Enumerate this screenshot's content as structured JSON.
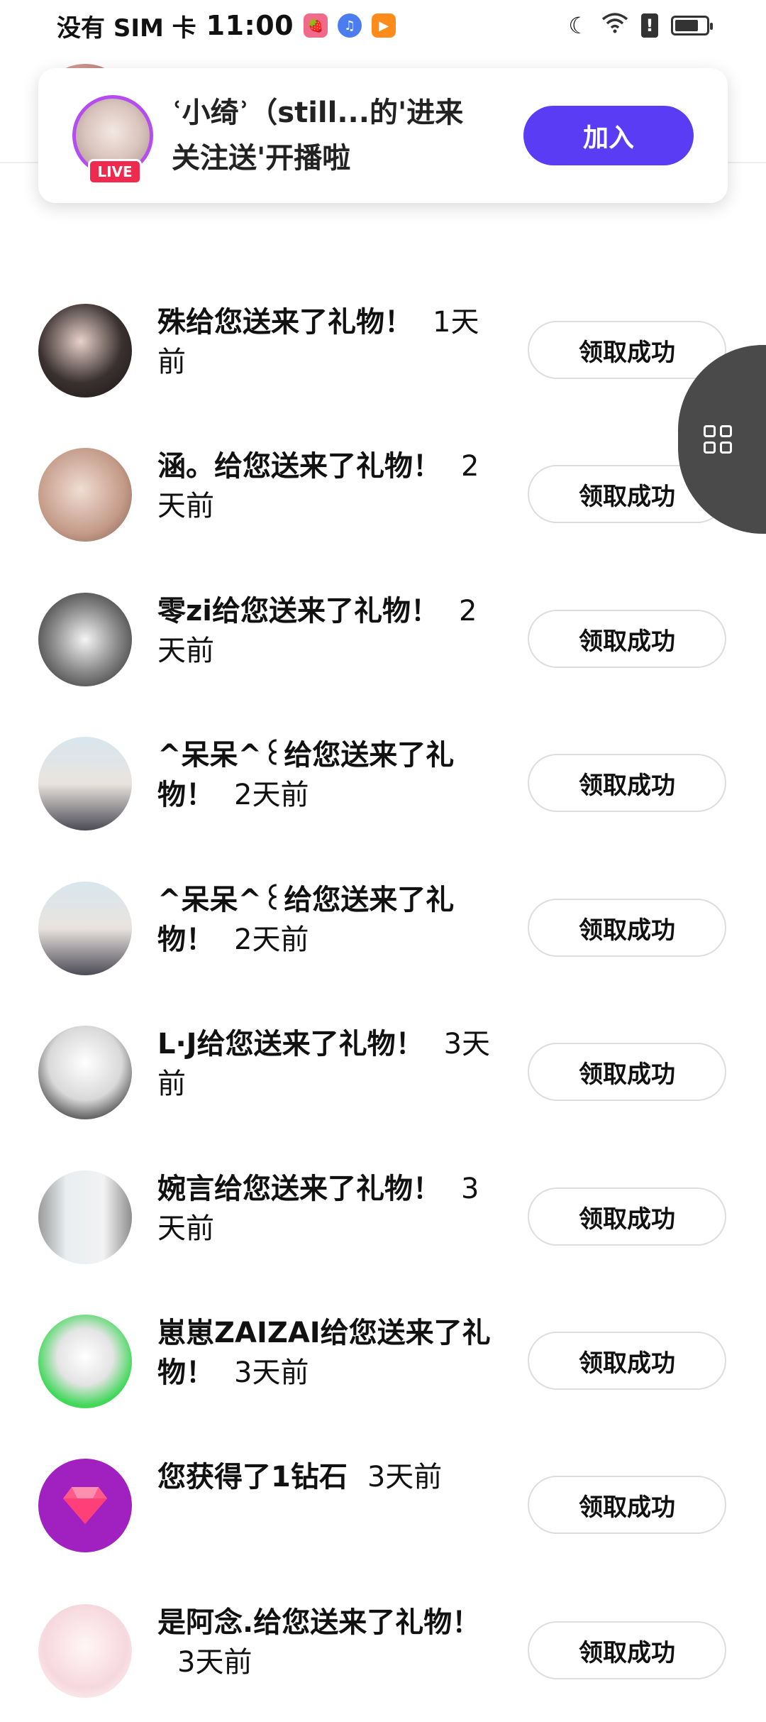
{
  "status_bar": {
    "carrier": "没有 SIM 卡",
    "time": "11:00",
    "app_icons": [
      "strawberry-app-icon",
      "music-icon",
      "video-play-icon"
    ],
    "right_icons": [
      "moon-icon",
      "wifi-icon",
      "alert-icon",
      "battery-icon"
    ],
    "battery_level": 0.75
  },
  "banner": {
    "text": "ʿ小绮ʾ（still...的'进来关注送'开播啦",
    "badge": "LIVE",
    "join_label": "加入"
  },
  "claim_label": "领取成功",
  "notifications": [
    {
      "message": "",
      "time": "天",
      "avatar": "photo-avatar"
    },
    {
      "message": "殊给您送来了礼物！",
      "time": "1天前",
      "avatar": "photo-avatar"
    },
    {
      "message": "涵。给您送来了礼物！",
      "time": "2天前",
      "avatar": "photo-avatar"
    },
    {
      "message": "零zi给您送来了礼物！",
      "time": "2天前",
      "avatar": "illustration-avatar"
    },
    {
      "message": "^呆呆^꒰给您送来了礼物！",
      "time": "2天前",
      "avatar": "photo-avatar"
    },
    {
      "message": "^呆呆^꒰给您送来了礼物！",
      "time": "2天前",
      "avatar": "photo-avatar"
    },
    {
      "message": "L·J给您送来了礼物！",
      "time": "3天前",
      "avatar": "illustration-avatar"
    },
    {
      "message": "婉言给您送来了礼物！",
      "time": "3天前",
      "avatar": "illustration-avatar"
    },
    {
      "message": "崽崽ZAIZAI给您送来了礼物！",
      "time": "3天前",
      "avatar": "illustration-avatar"
    },
    {
      "message": "您获得了1钻石",
      "time": "3天前",
      "avatar": "diamond-icon"
    },
    {
      "message": "是阿念.给您送来了礼物！",
      "time": "3天前",
      "avatar": "illustration-avatar"
    }
  ],
  "floating_button_icon": "grid-icon",
  "colors": {
    "join_button": "#5b3cf5",
    "live_badge": "#f02a4f",
    "live_ring": "#b54cf0",
    "floating_tab": "#4a4a4a",
    "diamond_bg": "#a020c0"
  }
}
